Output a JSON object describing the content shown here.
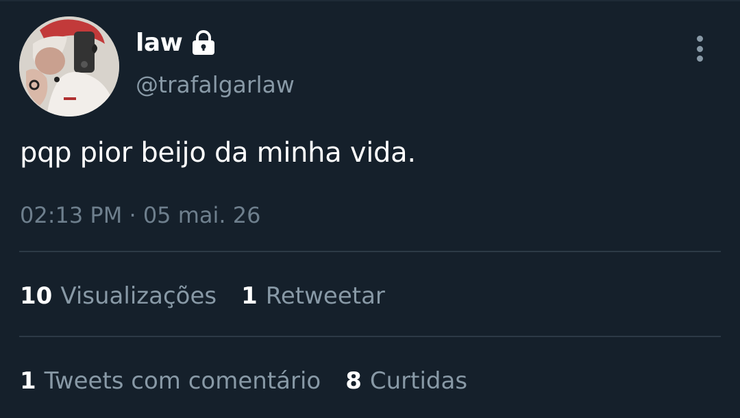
{
  "profile": {
    "display_name": "law",
    "handle": "@trafalgarlaw",
    "lock_icon": "lock-icon",
    "avatar_icon": "profile-photo"
  },
  "menu": {
    "icon": "more-vertical-icon"
  },
  "tweet": {
    "text": "pqp pior beijo da minha vida.",
    "timestamp": "02:13 PM · 05 mai. 26"
  },
  "stats": {
    "views": {
      "count": "10",
      "label": "Visualizações"
    },
    "retweets": {
      "count": "1",
      "label": "Retweetar"
    },
    "quotes": {
      "count": "1",
      "label": "Tweets com comentário"
    },
    "likes": {
      "count": "8",
      "label": "Curtidas"
    }
  },
  "colors": {
    "background": "#15202b",
    "primary_text": "#ffffff",
    "secondary_text": "#8899a6",
    "divider": "#2d3a46"
  }
}
